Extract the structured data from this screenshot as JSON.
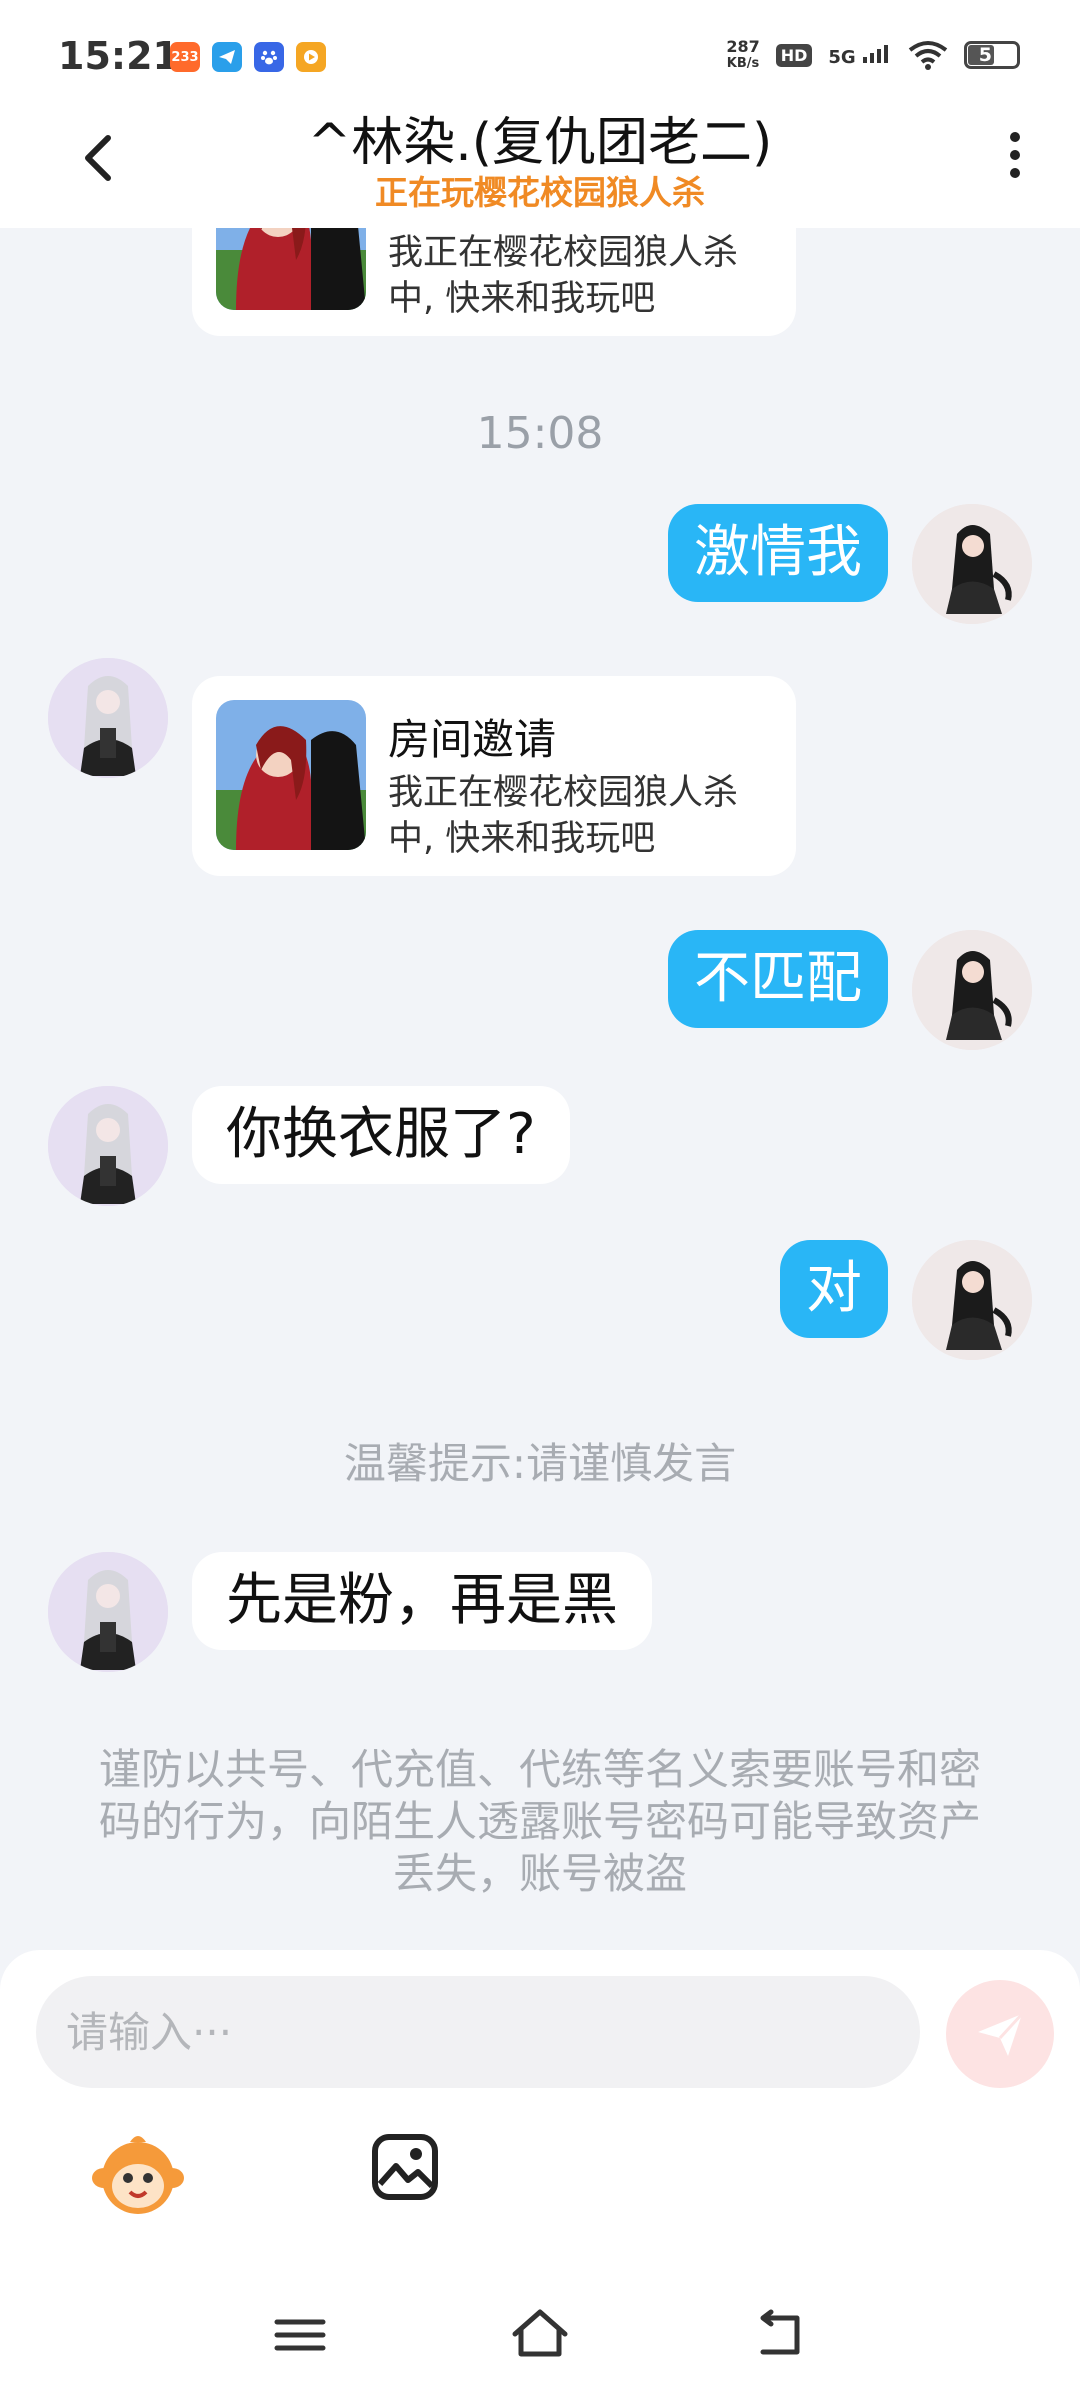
{
  "status_bar": {
    "time": "15:21",
    "app_icons": [
      {
        "name": "233-app-icon",
        "label": "233",
        "color": "#ff6a2b"
      },
      {
        "name": "telegram-icon",
        "label": "",
        "color": "#2a9fea"
      },
      {
        "name": "baidu-paw-icon",
        "label": "",
        "color": "#3867e6"
      },
      {
        "name": "video-app-icon",
        "label": "",
        "color": "#f5a623"
      }
    ],
    "net_speed_value": "287",
    "net_speed_unit": "KB/s",
    "hd": "HD",
    "signal": "5G",
    "battery": "51"
  },
  "header": {
    "title": "^林染.(复仇团老二)",
    "subtitle": "正在玩樱花校园狼人杀"
  },
  "messages": {
    "partial_invite_desc": "我正在樱花校园狼人杀中, 快来和我玩吧",
    "timestamp": "15:08",
    "out_1": "激情我",
    "invite": {
      "title": "房间邀请",
      "desc": "我正在樱花校园狼人杀中, 快来和我玩吧"
    },
    "out_2": "不匹配",
    "in_1": "你换衣服了?",
    "out_3": "对",
    "hint": "温馨提示:请谨慎发言",
    "in_2": "先是粉，再是黑",
    "warning": "谨防以共号、代充值、代练等名义索要账号和密码的行为，向陌生人透露账号密码可能导致资产丢失，账号被盗"
  },
  "composer": {
    "placeholder": "请输入···",
    "send_icon": "send-icon",
    "tools": [
      "emoji-mascot-icon",
      "image-icon"
    ]
  },
  "navbar": [
    "menu-icon",
    "home-icon",
    "back-icon"
  ],
  "colors": {
    "accent_blue": "#29b6f6",
    "subtitle_orange": "#f08a24",
    "background": "#f2f4f8"
  }
}
